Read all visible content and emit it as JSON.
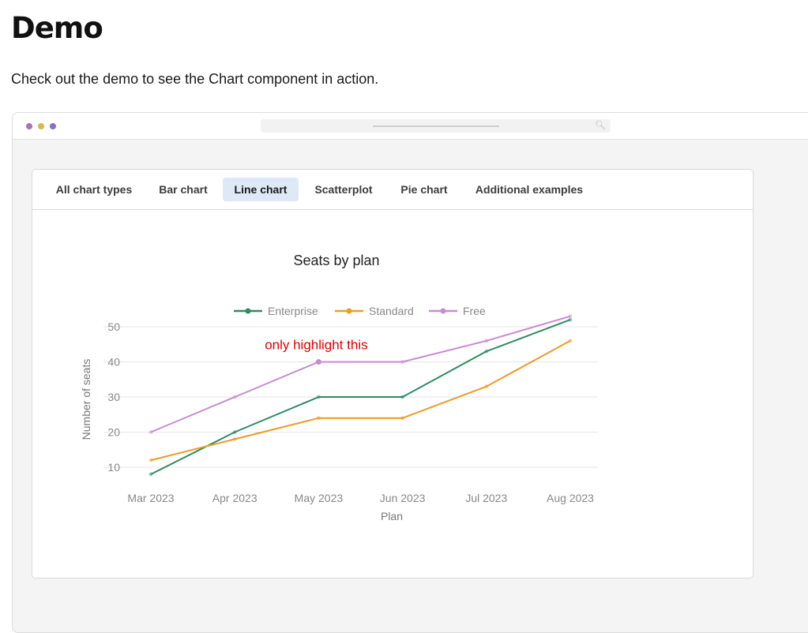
{
  "page": {
    "heading": "Demo",
    "intro": "Check out the demo to see the Chart component in action."
  },
  "browser": {
    "dot_colors": [
      "#a673b5",
      "#d9b84a",
      "#8a6fc9"
    ],
    "url_icon": "search-icon"
  },
  "tabs": [
    {
      "label": "All chart types",
      "active": false
    },
    {
      "label": "Bar chart",
      "active": false
    },
    {
      "label": "Line chart",
      "active": true
    },
    {
      "label": "Scatterplot",
      "active": false
    },
    {
      "label": "Pie chart",
      "active": false
    },
    {
      "label": "Additional examples",
      "active": false
    }
  ],
  "chart_data": {
    "type": "line",
    "title": "Seats by plan",
    "xlabel": "Plan",
    "ylabel": "Number of seats",
    "categories": [
      "Mar 2023",
      "Apr 2023",
      "May 2023",
      "Jun 2023",
      "Jul 2023",
      "Aug 2023"
    ],
    "ylim": [
      5,
      55
    ],
    "yticks": [
      10,
      20,
      30,
      40,
      50
    ],
    "grid": true,
    "legend_position": "top",
    "series": [
      {
        "name": "Enterprise",
        "color": "#2e8b62",
        "values": [
          8,
          20,
          30,
          30,
          43,
          52
        ]
      },
      {
        "name": "Standard",
        "color": "#eb9c28",
        "values": [
          12,
          18,
          24,
          24,
          33,
          46
        ]
      },
      {
        "name": "Free",
        "color": "#c88ad3",
        "values": [
          20,
          30,
          40,
          40,
          46,
          53
        ]
      }
    ],
    "annotation": {
      "text": "only highlight this",
      "color": "#e00000",
      "series": "Free",
      "category": "May 2023"
    }
  }
}
